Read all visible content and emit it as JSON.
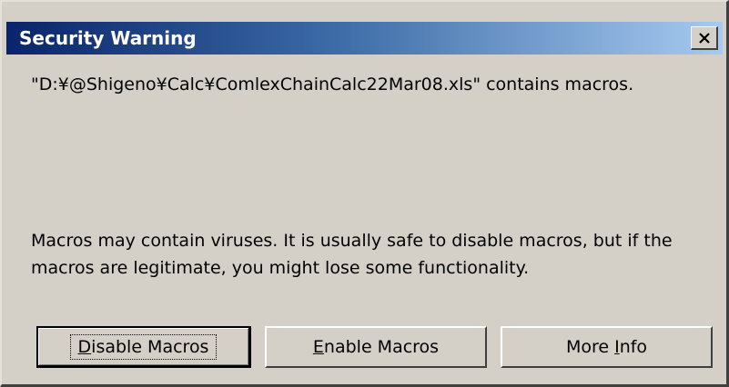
{
  "dialog": {
    "title": "Security Warning",
    "close_icon": "close-icon",
    "message": "\"D:¥@Shigeno¥Calc¥ComlexChainCalc22Mar08.xls\" contains macros.",
    "warning": "Macros may contain viruses. It is usually safe to disable macros, but if the macros are legitimate, you might lose some functionality.",
    "buttons": {
      "disable": {
        "accel": "D",
        "rest": "isable Macros"
      },
      "enable": {
        "accel": "E",
        "rest": "nable Macros"
      },
      "more": {
        "pre": "More ",
        "accel": "I",
        "rest": "nfo"
      }
    }
  },
  "colors": {
    "title_gradient_start": "#0a246a",
    "title_gradient_end": "#a6caf0",
    "face": "#d4d0c8"
  }
}
